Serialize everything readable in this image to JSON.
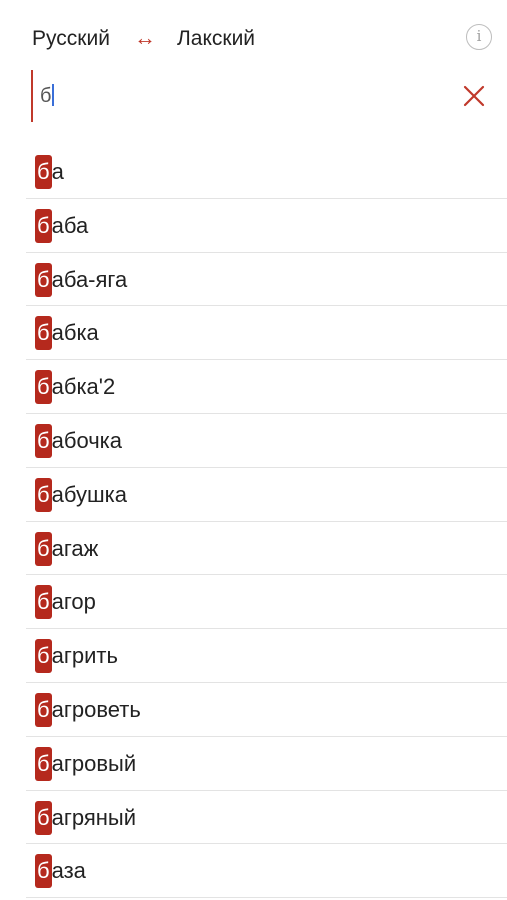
{
  "header": {
    "lang_from": "Русский",
    "swap_symbol": "↔",
    "lang_to": "Лакский",
    "info_symbol": "i"
  },
  "search": {
    "value": "б",
    "clear_icon": "close-icon"
  },
  "results": [
    {
      "match": "б",
      "rest": "а"
    },
    {
      "match": "б",
      "rest": "аба"
    },
    {
      "match": "б",
      "rest": "аба-яга"
    },
    {
      "match": "б",
      "rest": "абка"
    },
    {
      "match": "б",
      "rest": "абка'2"
    },
    {
      "match": "б",
      "rest": "абочка"
    },
    {
      "match": "б",
      "rest": "абушка"
    },
    {
      "match": "б",
      "rest": "агаж"
    },
    {
      "match": "б",
      "rest": "агор"
    },
    {
      "match": "б",
      "rest": "агрить"
    },
    {
      "match": "б",
      "rest": "агроветь"
    },
    {
      "match": "б",
      "rest": "агровый"
    },
    {
      "match": "б",
      "rest": "агряный"
    },
    {
      "match": "б",
      "rest": "аза"
    }
  ],
  "colors": {
    "accent": "#c0392b",
    "highlight": "#b5291d",
    "divider": "#e3e3e3"
  }
}
